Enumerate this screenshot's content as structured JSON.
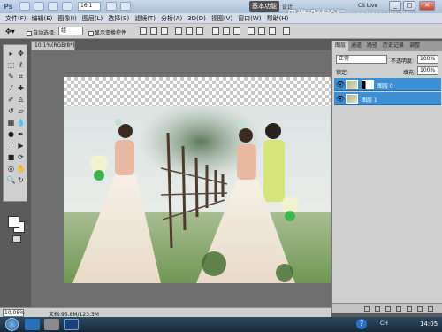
{
  "app": {
    "logo": "Ps",
    "zoom": "16.1",
    "workspace_button": "基本功能",
    "design_label": "设计",
    "cs_live": "CS Live",
    "watermark": "思缘设计论坛",
    "watermark_url": "www.MISSYUAN.COM",
    "window_controls": [
      "_",
      "□",
      "✕"
    ]
  },
  "menu": [
    "文件(F)",
    "编辑(E)",
    "图像(I)",
    "图层(L)",
    "选择(S)",
    "滤镜(T)",
    "分析(A)",
    "3D(D)",
    "视图(V)",
    "窗口(W)",
    "帮助(H)"
  ],
  "options": {
    "auto_select": "自动选择:",
    "group_value": "组",
    "show_transform": "显示变换控件"
  },
  "document": {
    "tab_title": "10.1%(RGB/8*)",
    "zoom_value": "10.08%",
    "doc_info": "文档:95.8M/123.3M"
  },
  "layers_panel": {
    "tabs": [
      "图层",
      "通道",
      "路径",
      "历史记录",
      "调整"
    ],
    "blend_mode": "正常",
    "opacity_label": "不透明度:",
    "opacity_value": "100%",
    "lock_label": "锁定:",
    "fill_label": "填充:",
    "fill_value": "100%",
    "layers": [
      {
        "name": "图层 0"
      },
      {
        "name": "图层 1"
      }
    ]
  },
  "taskbar": {
    "tray_text": "CH",
    "clock": "14:05"
  }
}
